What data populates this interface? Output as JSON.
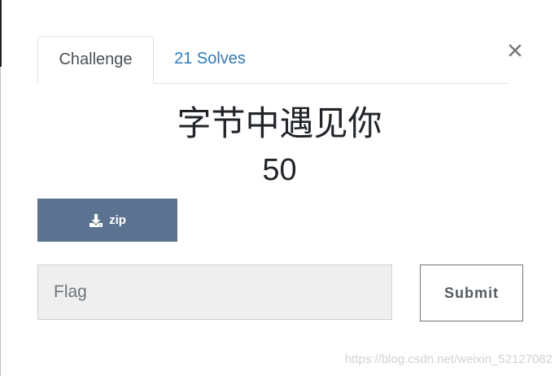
{
  "tabs": {
    "challenge_label": "Challenge",
    "solves_label": "21 Solves"
  },
  "close_icon": "close-icon",
  "challenge": {
    "name": "字节中遇见你",
    "value": "50"
  },
  "file_button": {
    "icon": "download-icon",
    "label": "zip"
  },
  "flag_input": {
    "value": "",
    "placeholder": "Flag"
  },
  "submit_label": "Submit",
  "watermark": "https://blog.csdn.net/weixin_52127082",
  "colors": {
    "file_button_bg": "#5b7290",
    "solves_link": "#337ab7",
    "input_bg": "#efefef"
  }
}
